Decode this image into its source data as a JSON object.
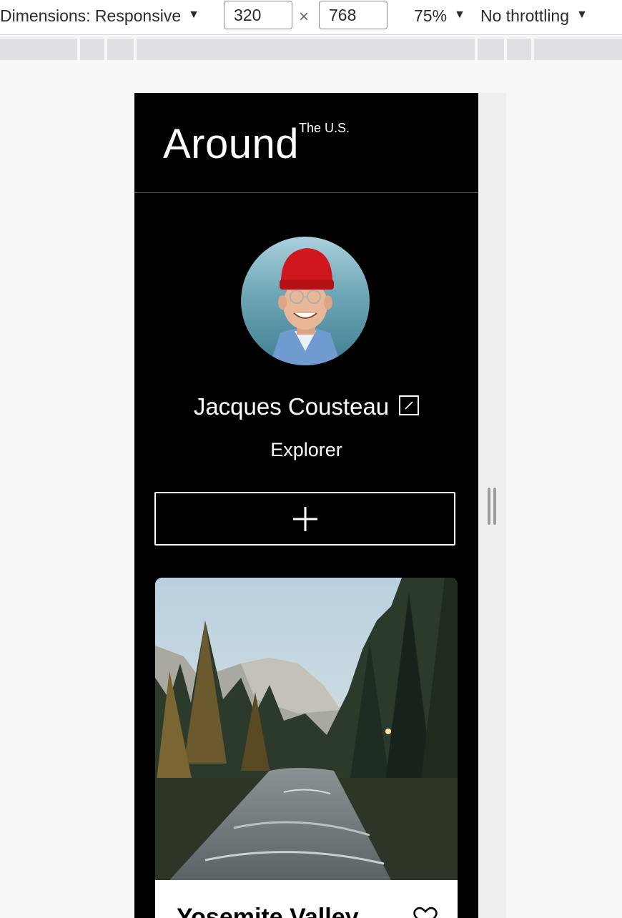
{
  "devtools": {
    "dimensions_label": "Dimensions: Responsive",
    "width_value": "320",
    "times_symbol": "×",
    "height_value": "768",
    "zoom_label": "75%",
    "throttling_label": "No throttling",
    "caret": "▼"
  },
  "header": {
    "logo_text": "Around",
    "logo_superscript": "The U.S."
  },
  "profile": {
    "name": "Jacques Cousteau",
    "job": "Explorer",
    "avatar_icon": "avatar-photo",
    "edit_icon": "pencil-icon",
    "add_icon": "plus-icon"
  },
  "cards": [
    {
      "title": "Yosemite Valley",
      "like_icon": "heart-icon"
    }
  ],
  "colors": {
    "page_bg": "#000000",
    "text": "#ffffff",
    "avatar_hat": "#d0171d"
  }
}
